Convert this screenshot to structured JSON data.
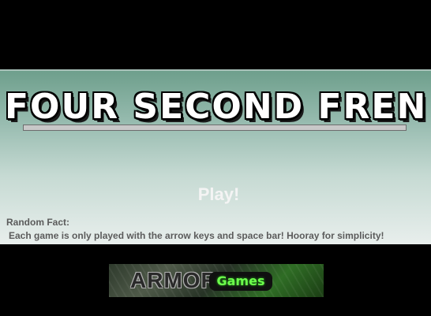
{
  "game": {
    "title": "Four Second Frenzy",
    "progress": 0,
    "play_label": "Play!",
    "fact_label": "Random Fact:",
    "fact_text": "Each game is only played with the arrow keys and space bar!  Hooray for simplicity!"
  },
  "sponsor": {
    "word1": "ARMOR",
    "word2": "Games"
  },
  "colors": {
    "background": "#000000",
    "panel_top": "#6e9f8c",
    "panel_bottom": "#e9efed",
    "fact_text": "#5b5b5b",
    "sponsor_accent": "#6dff4c"
  }
}
